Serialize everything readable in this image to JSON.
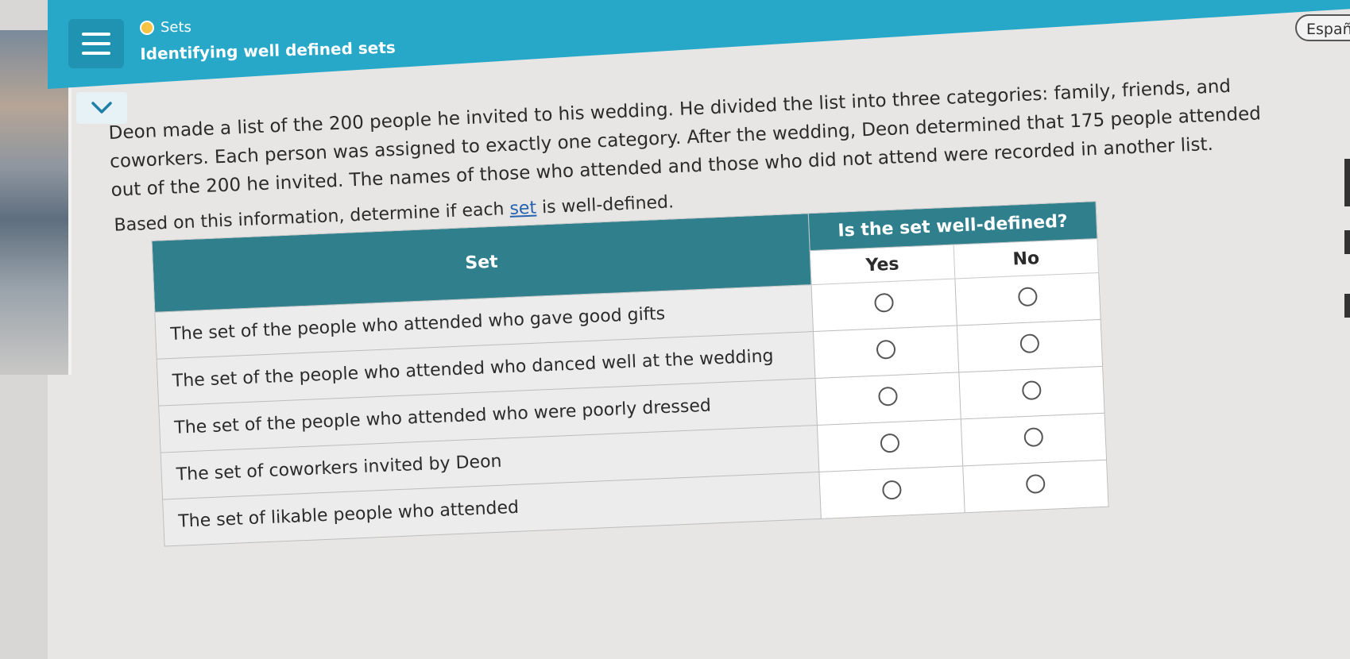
{
  "header": {
    "topic": "Sets",
    "lesson_title": "Identifying well defined sets",
    "language_button": "Españ"
  },
  "problem": {
    "text": "Deon made a list of the 200 people he invited to his wedding. He divided the list into three categories: family, friends, and coworkers. Each person was assigned to exactly one category. After the wedding, Deon determined that 175 people attended out of the 200 he invited. The names of those who attended and those who did not attend were recorded in another list.",
    "prompt_before": "Based on this information, determine if each ",
    "prompt_link": "set",
    "prompt_after": " is well-defined."
  },
  "table": {
    "set_header": "Set",
    "question_header": "Is the set well-defined?",
    "yes_label": "Yes",
    "no_label": "No",
    "rows": [
      "The set of the people who attended who gave good gifts",
      "The set of the people who attended who danced well at the wedding",
      "The set of the people who attended who were poorly dressed",
      "The set of coworkers invited by Deon",
      "The set of likable people who attended"
    ]
  },
  "colors": {
    "header_bar": "#27a8c9",
    "table_header": "#2f7f8d",
    "link": "#2563b0"
  }
}
